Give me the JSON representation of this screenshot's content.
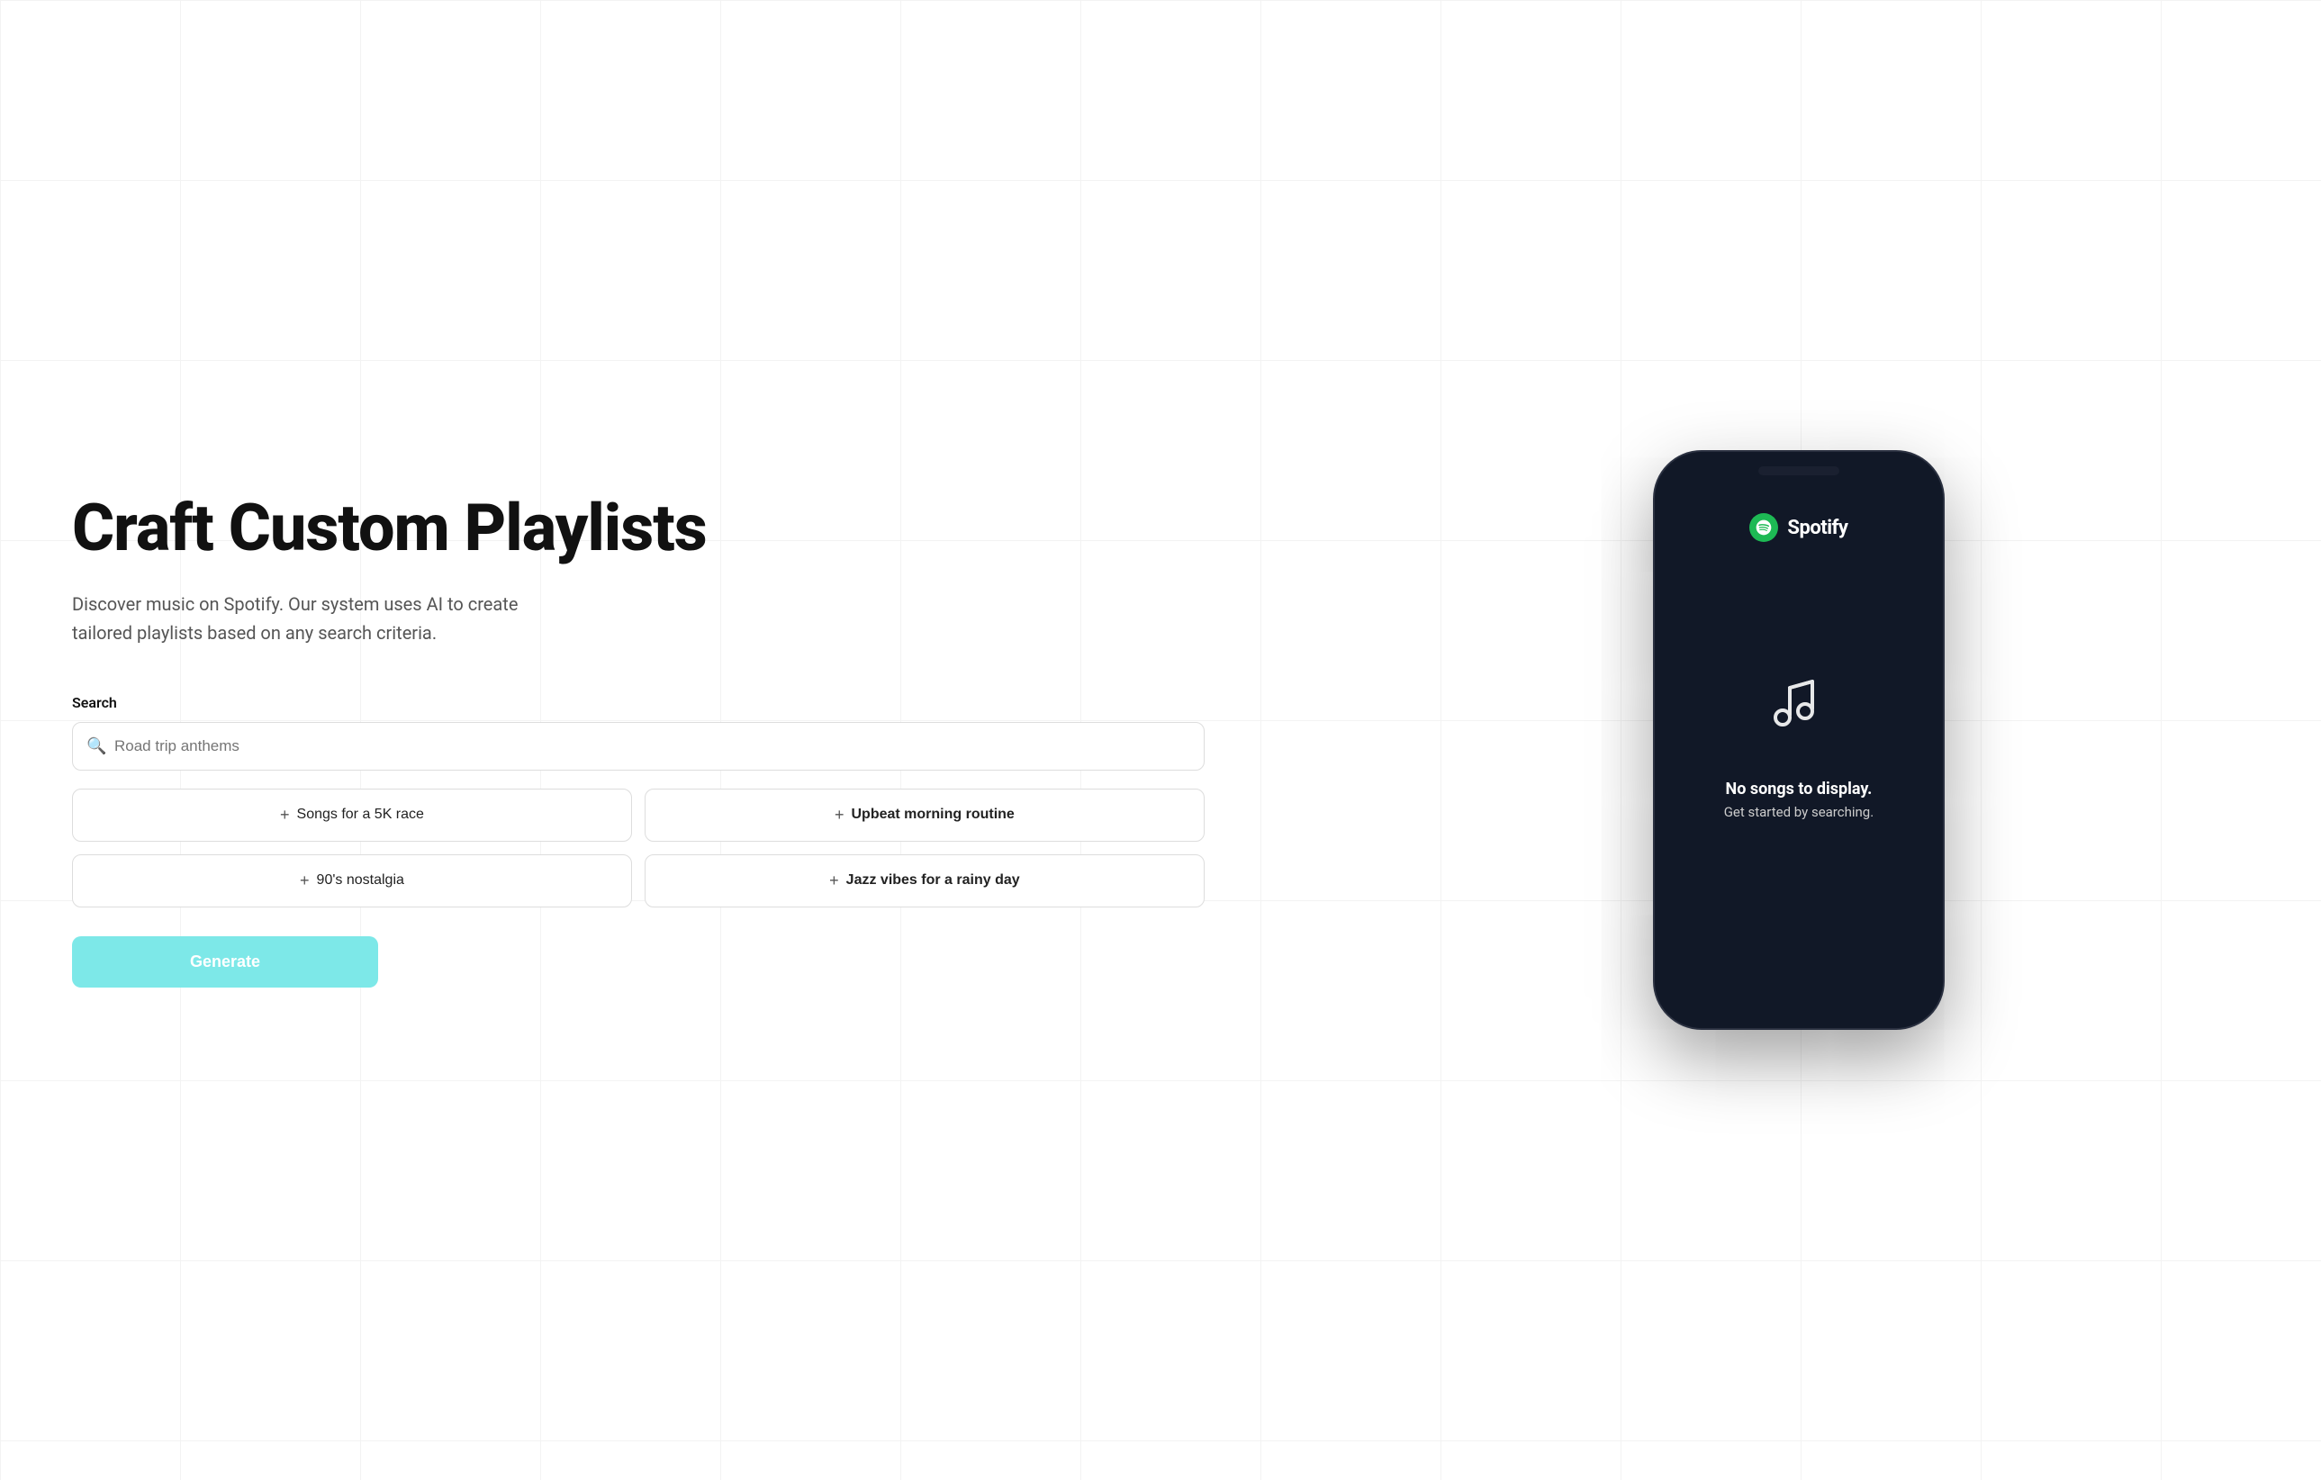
{
  "page": {
    "title": "Craft Custom Playlists",
    "subtitle": "Discover music on Spotify. Our system uses AI to create tailored playlists based on any search criteria.",
    "search": {
      "label": "Search",
      "placeholder": "Road trip anthems"
    },
    "suggestions": [
      {
        "id": "5k-race",
        "label": "Songs for a 5K race",
        "bold": false
      },
      {
        "id": "morning-routine",
        "label": "Upbeat morning routine",
        "bold": true
      },
      {
        "id": "90s-nostalgia",
        "label": "90's nostalgia",
        "bold": false
      },
      {
        "id": "jazz-vibes",
        "label": "Jazz vibes for a rainy day",
        "bold": true
      }
    ],
    "generate_button": "Generate"
  },
  "phone": {
    "spotify_brand": "Spotify",
    "no_songs_title": "No songs to display.",
    "no_songs_subtitle": "Get started by searching."
  },
  "icons": {
    "search": "🔍",
    "plus": "+",
    "music_note": "♪"
  }
}
